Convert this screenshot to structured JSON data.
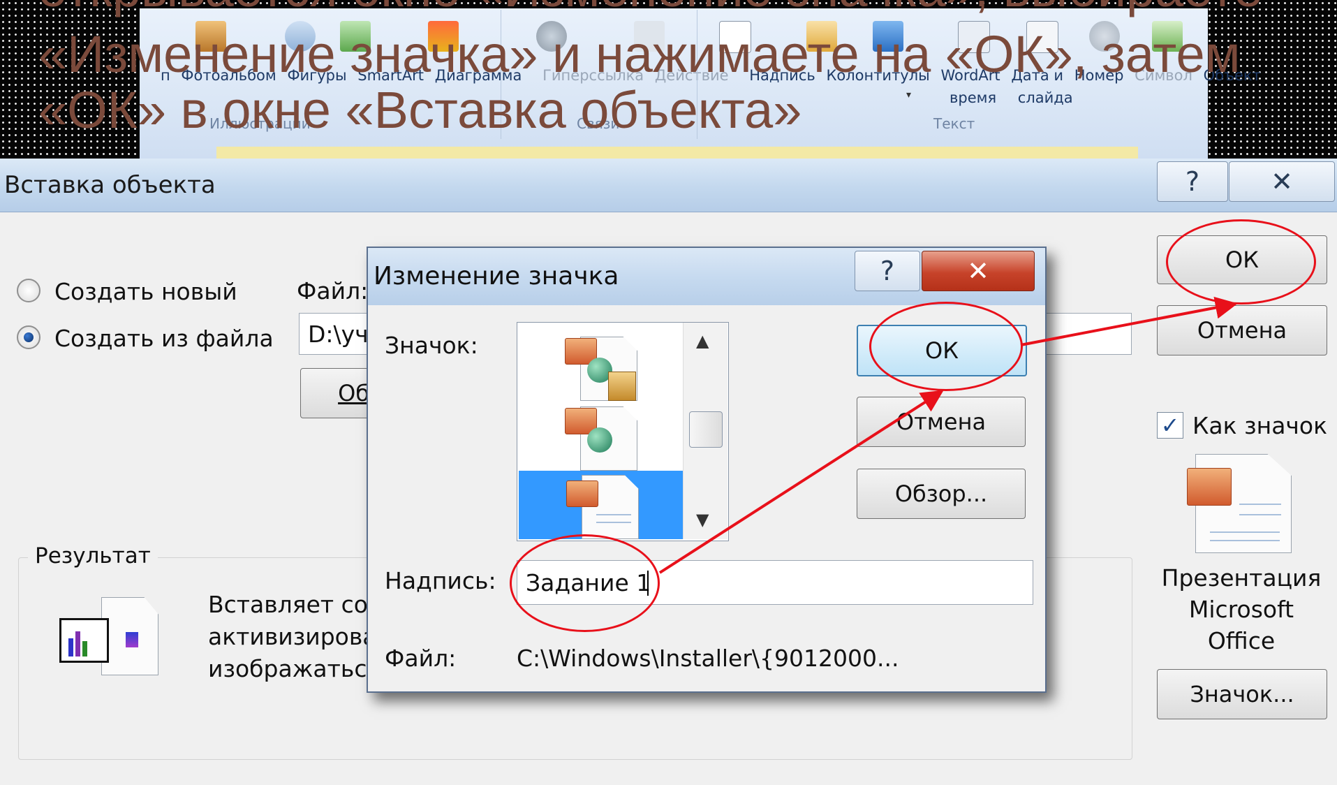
{
  "slide": {
    "title_top_fragment": "открывается окно «Изменение значка», выбираете",
    "title": "«Изменение значка» и нажимаете на «ОК», затем «ОК» в окне «Вставка объекта»"
  },
  "ribbon": {
    "items": [
      "Фотоальбом",
      "Фигуры",
      "SmartArt",
      "Диаграмма"
    ],
    "dim_items": [
      "Гиперссылка",
      "Действие"
    ],
    "text_items": [
      "Надпись",
      "Колонтитулы",
      "WordArt",
      "Дата и",
      "Номер"
    ],
    "dim_text_items": [
      "Символ"
    ],
    "last_item": "Объект",
    "second_line": [
      "время",
      "слайда"
    ],
    "groups": {
      "illustrations": "Иллюстрации",
      "links": "Связи",
      "text": "Текст"
    },
    "partial_left": "п"
  },
  "main_dialog": {
    "title": "Вставка объекта",
    "help_glyph": "?",
    "close_glyph": "✕",
    "radio_new": "Создать новый",
    "radio_from_file": "Создать из файла",
    "file_label": "Файл:",
    "file_value": "D:\\уч",
    "browse_partial": "Об",
    "ok": "ОК",
    "cancel": "Отмена",
    "as_icon_label": "Как значок",
    "icon_caption": [
      "Презентация",
      "Microsoft",
      "Office"
    ],
    "change_icon": "Значок...",
    "result_label": "Результат",
    "result_text": [
      "Вставляет со",
      "активизирова",
      "изображатьс"
    ]
  },
  "change_icon_dialog": {
    "title": "Изменение значка",
    "help_glyph": "?",
    "close_glyph": "✕",
    "icon_label": "Значок:",
    "ok": "ОК",
    "cancel": "Отмена",
    "browse": "Обзор...",
    "caption_label": "Надпись:",
    "caption_value": "Задание 1",
    "file_label": "Файл:",
    "file_value": "C:\\Windows\\Installer\\{9012000..."
  },
  "colors": {
    "annotation": "#e8101a",
    "slide_title": "#7b4a3b",
    "selection": "#3399ff"
  },
  "icons": [
    "arrow-up-icon",
    "arrow-down-icon",
    "scroll-grip-icon",
    "checkbox-check-icon",
    "powerpoint-document-icon",
    "chart-object-icon"
  ]
}
